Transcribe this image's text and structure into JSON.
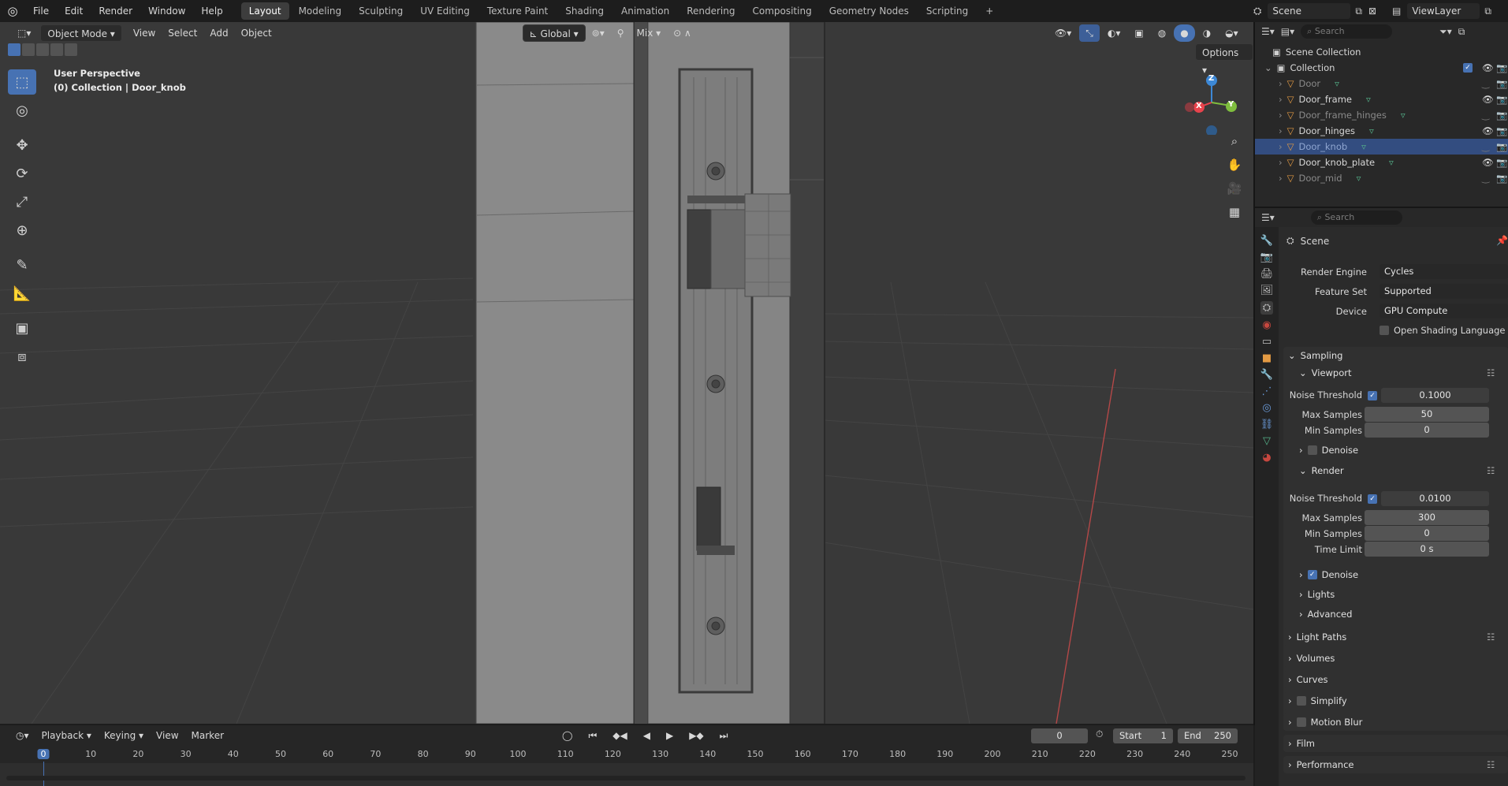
{
  "topbar": {
    "menus": [
      "File",
      "Edit",
      "Render",
      "Window",
      "Help"
    ],
    "workspaces": [
      "Layout",
      "Modeling",
      "Sculpting",
      "UV Editing",
      "Texture Paint",
      "Shading",
      "Animation",
      "Rendering",
      "Compositing",
      "Geometry Nodes",
      "Scripting"
    ],
    "active_workspace": "Layout",
    "add_workspace": "+",
    "scene": "Scene",
    "view_layer": "ViewLayer"
  },
  "viewport": {
    "mode": "Object Mode",
    "menus": [
      "View",
      "Select",
      "Add",
      "Object"
    ],
    "orientation": "Global",
    "pivot_blend": "Mix",
    "options": "Options",
    "overlay_title": "User Perspective",
    "overlay_subtitle": "(0) Collection | Door_knob",
    "gizmo": {
      "x": "X",
      "y": "Y",
      "z": "Z"
    }
  },
  "outliner": {
    "search_placeholder": "Search",
    "scene_collection": "Scene Collection",
    "collection": "Collection",
    "items": [
      {
        "name": "Door",
        "visible": false,
        "selected": false
      },
      {
        "name": "Door_frame",
        "visible": true,
        "selected": false
      },
      {
        "name": "Door_frame_hinges",
        "visible": false,
        "selected": false
      },
      {
        "name": "Door_hinges",
        "visible": true,
        "selected": false
      },
      {
        "name": "Door_knob",
        "visible": false,
        "selected": true
      },
      {
        "name": "Door_knob_plate",
        "visible": true,
        "selected": false
      },
      {
        "name": "Door_mid",
        "visible": false,
        "selected": false
      }
    ]
  },
  "properties": {
    "search_placeholder": "Search",
    "context": "Scene",
    "render_engine_label": "Render Engine",
    "render_engine": "Cycles",
    "feature_set_label": "Feature Set",
    "feature_set": "Supported",
    "device_label": "Device",
    "device": "GPU Compute",
    "osl_label": "Open Shading Language",
    "sampling": "Sampling",
    "viewport_panel": "Viewport",
    "render_panel": "Render",
    "noise_threshold_label": "Noise Threshold",
    "max_samples_label": "Max Samples",
    "min_samples_label": "Min Samples",
    "time_limit_label": "Time Limit",
    "denoise_label": "Denoise",
    "viewport_noise_threshold": "0.1000",
    "viewport_max_samples": "50",
    "viewport_min_samples": "0",
    "render_noise_threshold": "0.0100",
    "render_max_samples": "300",
    "render_min_samples": "0",
    "render_time_limit": "0 s",
    "subpanels": [
      "Lights",
      "Advanced"
    ],
    "panels": [
      "Light Paths",
      "Volumes",
      "Curves",
      "Simplify",
      "Motion Blur",
      "Film",
      "Performance"
    ]
  },
  "timeline": {
    "menus": [
      "Playback",
      "Keying",
      "View",
      "Marker"
    ],
    "current_frame": "0",
    "start_label": "Start",
    "start": "1",
    "end_label": "End",
    "end": "250",
    "ruler": [
      "0",
      "10",
      "20",
      "30",
      "40",
      "50",
      "60",
      "70",
      "80",
      "90",
      "100",
      "110",
      "120",
      "130",
      "140",
      "150",
      "160",
      "170",
      "180",
      "190",
      "200",
      "210",
      "220",
      "230",
      "240",
      "250"
    ]
  },
  "colors": {
    "accent": "#4772b3",
    "selection": "#334d80",
    "object_icon": "#e39a43",
    "mesh_icon": "#55b38a",
    "axis_x": "#e8434c",
    "axis_y": "#7fbe3e",
    "axis_z": "#3d88d6"
  }
}
